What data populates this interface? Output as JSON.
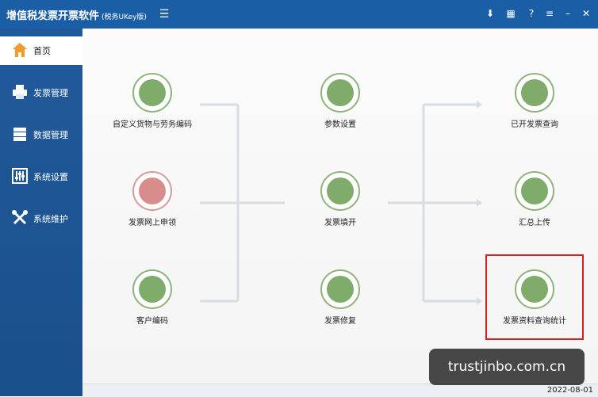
{
  "titlebar": {
    "app_title": "增值税发票开票软件",
    "app_subtitle": "(税务UKey版)",
    "menu_icon": "menu-lines-icon",
    "controls": [
      "download-icon",
      "grid-icon",
      "help-icon",
      "list-icon",
      "minimize-icon",
      "close-icon"
    ]
  },
  "sidebar": {
    "items": [
      {
        "label": "首页",
        "icon": "home-icon",
        "active": true
      },
      {
        "label": "发票管理",
        "icon": "printer-icon"
      },
      {
        "label": "数据管理",
        "icon": "database-icon"
      },
      {
        "label": "系统设置",
        "icon": "sliders-icon"
      },
      {
        "label": "系统维护",
        "icon": "tools-icon"
      }
    ]
  },
  "main": {
    "tiles": [
      {
        "label": "自定义货物与劳务编码",
        "icon": "goods-code-icon"
      },
      {
        "label": "发票网上申领",
        "icon": "online-apply-icon"
      },
      {
        "label": "客户编码",
        "icon": "customer-code-icon"
      },
      {
        "label": "参数设置",
        "icon": "parameter-settings-icon"
      },
      {
        "label": "发票填开",
        "icon": "invoice-fill-icon"
      },
      {
        "label": "发票修复",
        "icon": "invoice-repair-icon"
      },
      {
        "label": "已开发票查询",
        "icon": "issued-invoice-query-icon"
      },
      {
        "label": "汇总上传",
        "icon": "summary-upload-icon"
      },
      {
        "label": "发票资料查询统计",
        "icon": "invoice-stats-icon"
      }
    ],
    "highlight_color": "#d62020"
  },
  "statusbar": {
    "date": "2022-08-01"
  },
  "watermark": {
    "text": "trustjinbo.com.cn"
  },
  "colors": {
    "titlebar": "#1a5fa6",
    "sidebar": "#215a9c",
    "tile_green": "#7fab6b",
    "tile_pink": "#d98c8c"
  }
}
